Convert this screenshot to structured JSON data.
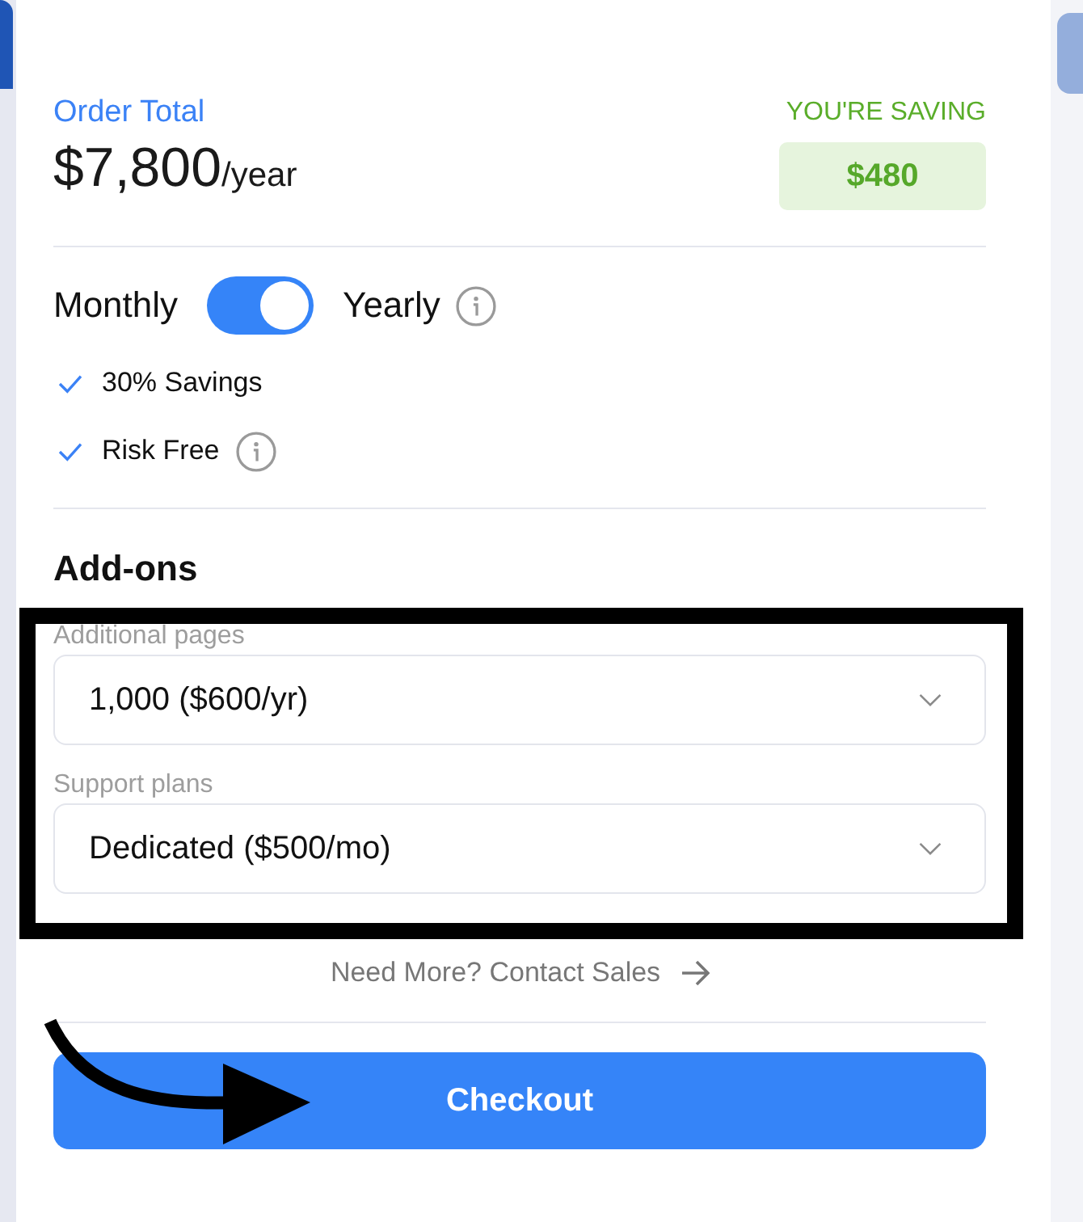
{
  "order_total": {
    "label": "Order Total",
    "amount": "$7,800",
    "period": "/year"
  },
  "savings": {
    "label": "YOU'RE SAVING",
    "amount": "$480"
  },
  "billing": {
    "left_label": "Monthly",
    "right_label": "Yearly",
    "on": true,
    "info": true
  },
  "benefits": [
    {
      "label": "30% Savings",
      "info": false
    },
    {
      "label": "Risk Free",
      "info": true
    }
  ],
  "addons": {
    "title": "Add-ons",
    "fields": [
      {
        "label": "Additional pages",
        "value": "1,000 ($600/yr)"
      },
      {
        "label": "Support plans",
        "value": "Dedicated ($500/mo)"
      }
    ]
  },
  "contact_link": "Need More? Contact Sales",
  "checkout_button": "Checkout",
  "annotations": [
    {
      "kind": "frame"
    },
    {
      "kind": "arrow"
    }
  ]
}
